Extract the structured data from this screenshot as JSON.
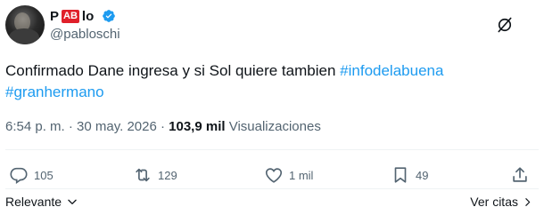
{
  "author": {
    "name_prefix": "P",
    "name_badge": "AB",
    "name_suffix": "lo",
    "apple_glyph": "",
    "handle": "@pabloschi",
    "verified_color": "#1d9bf0",
    "badge_color": "#e0202a"
  },
  "tweet": {
    "text": "Confirmado Dane ingresa y si Sol quiere tambien",
    "hashtag_1": "#infodelabuena",
    "hashtag_2": "#granhermano",
    "hashtag_color": "#1d9bf0"
  },
  "meta": {
    "time_date": "6:54 p. m. · 30 may. 2026 · ",
    "views_count": "103,9 mil",
    "views_label": "Visualizaciones"
  },
  "actions": {
    "replies": "105",
    "reposts": "129",
    "likes": "1 mil",
    "bookmarks": "49"
  },
  "footer": {
    "sort_label": "Relevante",
    "quotes_label": "Ver citas"
  },
  "icons": [
    "grok-icon",
    "verified-icon",
    "apple-icon",
    "reply-icon",
    "repost-icon",
    "like-icon",
    "bookmark-icon",
    "share-icon",
    "chevron-down-icon",
    "chevron-right-icon"
  ]
}
